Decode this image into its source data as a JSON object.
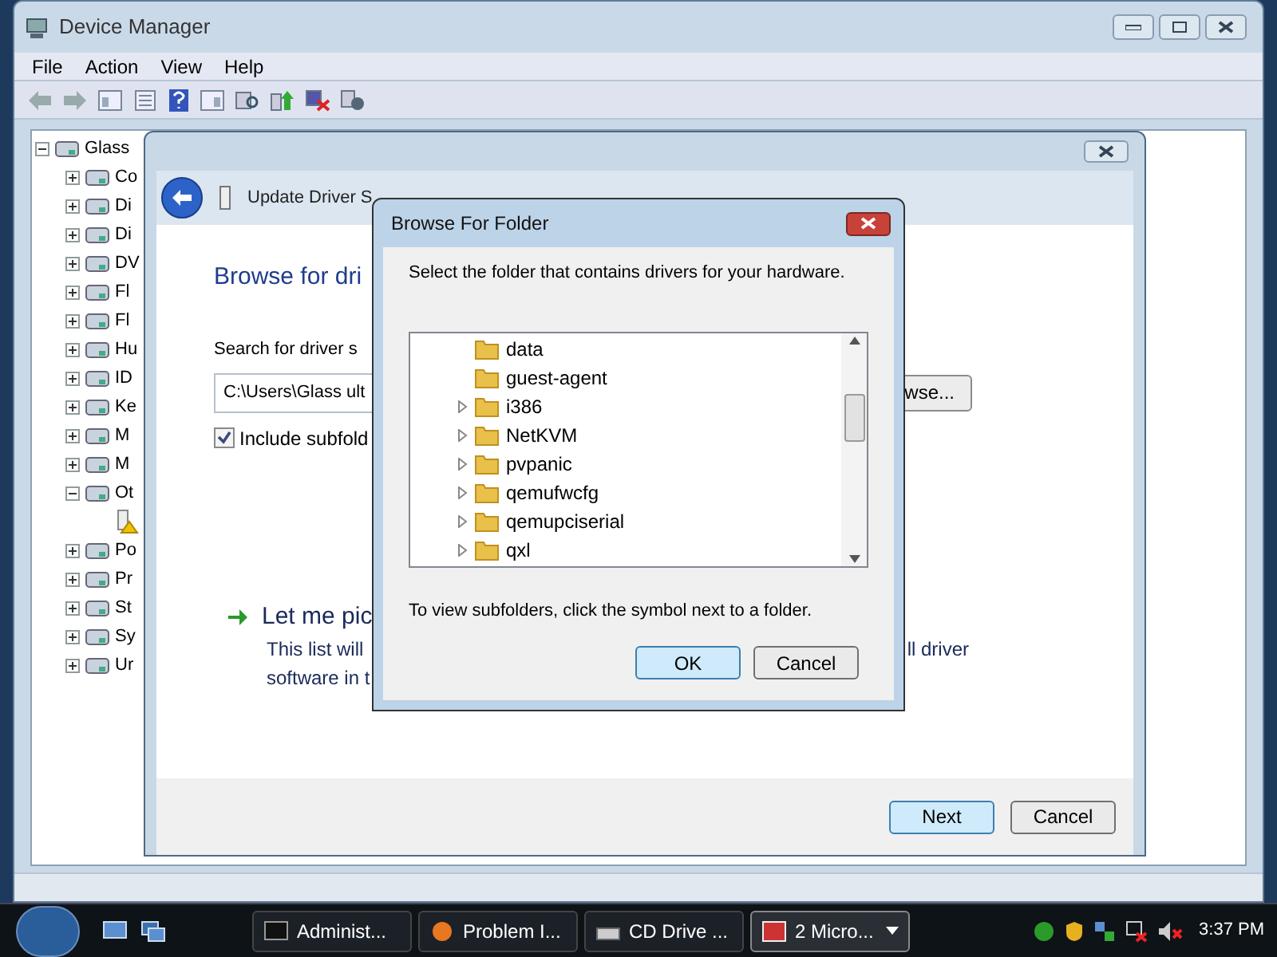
{
  "device_manager": {
    "title": "Device Manager",
    "menu": [
      "File",
      "Action",
      "View",
      "Help"
    ],
    "tree": [
      {
        "label": "Glass",
        "expanded": true,
        "warning": false,
        "children": [
          {
            "label": "Co",
            "expanded": false,
            "warning": false
          },
          {
            "label": "Di",
            "expanded": false,
            "warning": false
          },
          {
            "label": "Di",
            "expanded": false,
            "warning": false
          },
          {
            "label": "DV",
            "expanded": false,
            "warning": false
          },
          {
            "label": "Fl",
            "expanded": false,
            "warning": false
          },
          {
            "label": "Fl",
            "expanded": false,
            "warning": false
          },
          {
            "label": "Hu",
            "expanded": false,
            "warning": false
          },
          {
            "label": "ID",
            "expanded": false,
            "warning": false
          },
          {
            "label": "Ke",
            "expanded": false,
            "warning": false
          },
          {
            "label": "M",
            "expanded": false,
            "warning": false
          },
          {
            "label": "M",
            "expanded": false,
            "warning": false
          },
          {
            "label": "Ot",
            "expanded": true,
            "warning": false,
            "children": [
              {
                "warning": true
              }
            ]
          },
          {
            "label": "Po",
            "expanded": false,
            "warning": false
          },
          {
            "label": "Pr",
            "expanded": false,
            "warning": false
          },
          {
            "label": "St",
            "expanded": false,
            "warning": false
          },
          {
            "label": "Sy",
            "expanded": false,
            "warning": false
          },
          {
            "label": "Ur",
            "expanded": false,
            "warning": false
          }
        ]
      }
    ]
  },
  "update_driver": {
    "title": "Update Driver S",
    "heading": "Browse for dri",
    "search_label": "Search for driver s",
    "path_value": "C:\\Users\\Glass ult",
    "browse_button": "wse...",
    "include_subfolders": {
      "label": "Include subfold",
      "checked": true
    },
    "option": {
      "title": "Let me pic",
      "line_1_left": "This list will",
      "line_1_right": "ll driver",
      "line_2": "software in t"
    },
    "buttons": [
      {
        "label": "Next",
        "default": true
      },
      {
        "label": "Cancel",
        "default": false
      }
    ]
  },
  "browse_dialog": {
    "title": "Browse For Folder",
    "prompt": "Select the folder that contains drivers for your hardware.",
    "folders": [
      {
        "label": "data",
        "has_children": false
      },
      {
        "label": "guest-agent",
        "has_children": false
      },
      {
        "label": "i386",
        "has_children": true
      },
      {
        "label": "NetKVM",
        "has_children": true
      },
      {
        "label": "pvpanic",
        "has_children": true
      },
      {
        "label": "qemufwcfg",
        "has_children": true
      },
      {
        "label": "qemupciserial",
        "has_children": true
      },
      {
        "label": "qxl",
        "has_children": true
      }
    ],
    "note": "To view subfolders, click the symbol next to a folder.",
    "buttons": [
      {
        "label": "OK",
        "default": true
      },
      {
        "label": "Cancel",
        "default": false
      }
    ]
  },
  "taskbar": {
    "items": [
      {
        "label": "Administ...",
        "selected": false,
        "kind": "console"
      },
      {
        "label": "Problem I...",
        "selected": false,
        "kind": "browser"
      },
      {
        "label": "CD Drive ...",
        "selected": false,
        "kind": "drive"
      },
      {
        "label": "2 Micro...",
        "selected": true,
        "kind": "group"
      }
    ],
    "clock": "3:37 PM"
  }
}
